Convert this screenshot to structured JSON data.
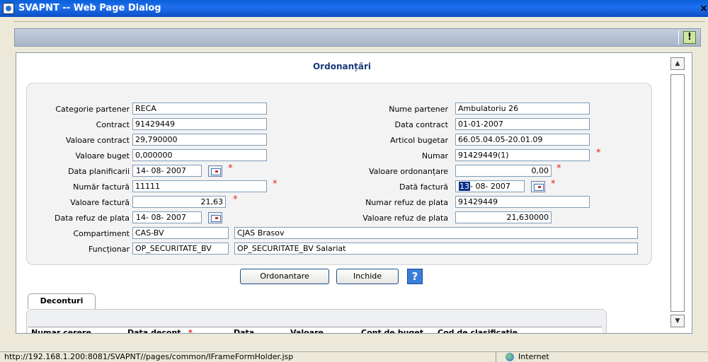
{
  "window": {
    "title": "SVAPNT -- Web Page Dialog",
    "close_glyph": "×"
  },
  "toolbar": {
    "help_glyph": "!"
  },
  "form": {
    "title": "Ordonanțări",
    "fields": {
      "categorie_partener": {
        "label": "Categorie partener",
        "value": "RECA"
      },
      "contract": {
        "label": "Contract",
        "value": "91429449"
      },
      "valoare_contract": {
        "label": "Valoare contract",
        "value": "29,790000"
      },
      "valoare_buget": {
        "label": "Valoare buget",
        "value": "0,000000"
      },
      "data_planificarii": {
        "label": "Data planificarii",
        "value": "14- 08-  2007"
      },
      "numar_factura": {
        "label": "Număr factură",
        "value": "11111"
      },
      "valoare_factura": {
        "label": "Valoare factură",
        "value": "21,63"
      },
      "data_refuz": {
        "label": "Data refuz de plata",
        "value": "14- 08-  2007"
      },
      "compartiment": {
        "label": "Compartiment",
        "code": "CAS-BV",
        "name": "CJAS Brasov"
      },
      "functionar": {
        "label": "Funcționar",
        "code": "OP_SECURITATE_BV",
        "name": "OP_SECURITATE_BV Salariat"
      },
      "nume_partener": {
        "label": "Nume partener",
        "value": "Ambulatoriu 26"
      },
      "data_contract": {
        "label": "Data contract",
        "value": "01-01-2007"
      },
      "articol_bugetar": {
        "label": "Articol bugetar",
        "value": "66.05.04.05-20.01.09"
      },
      "numar": {
        "label": "Numar",
        "value": "91429449(1)"
      },
      "valoare_ordonantare": {
        "label": "Valoare ordonanțare",
        "value": "0,00"
      },
      "data_factura": {
        "label": "Dată factură",
        "day": "13",
        "rest": "- 08-  2007"
      },
      "numar_refuz": {
        "label": "Numar refuz de plata",
        "value": "91429449"
      },
      "valoare_refuz": {
        "label": "Valoare refuz de plata",
        "value": "21,630000"
      }
    },
    "required_mark": "*",
    "buttons": {
      "ordonantare": "Ordonantare",
      "inchide": "Inchide",
      "help": "?"
    }
  },
  "tabs": [
    {
      "label": "Deconturi"
    }
  ],
  "grid": {
    "headers": [
      "Numar cerere",
      "Data decont",
      "*",
      "Data",
      "Valoare",
      "Cont de buget",
      "Cod de clasificatie"
    ]
  },
  "scrollbar": {
    "up": "▲",
    "down": "▼"
  },
  "status": {
    "url": "http://192.168.1.200:8081/SVAPNT//pages/common/IFrameFormHolder.jsp",
    "zone": "Internet"
  }
}
